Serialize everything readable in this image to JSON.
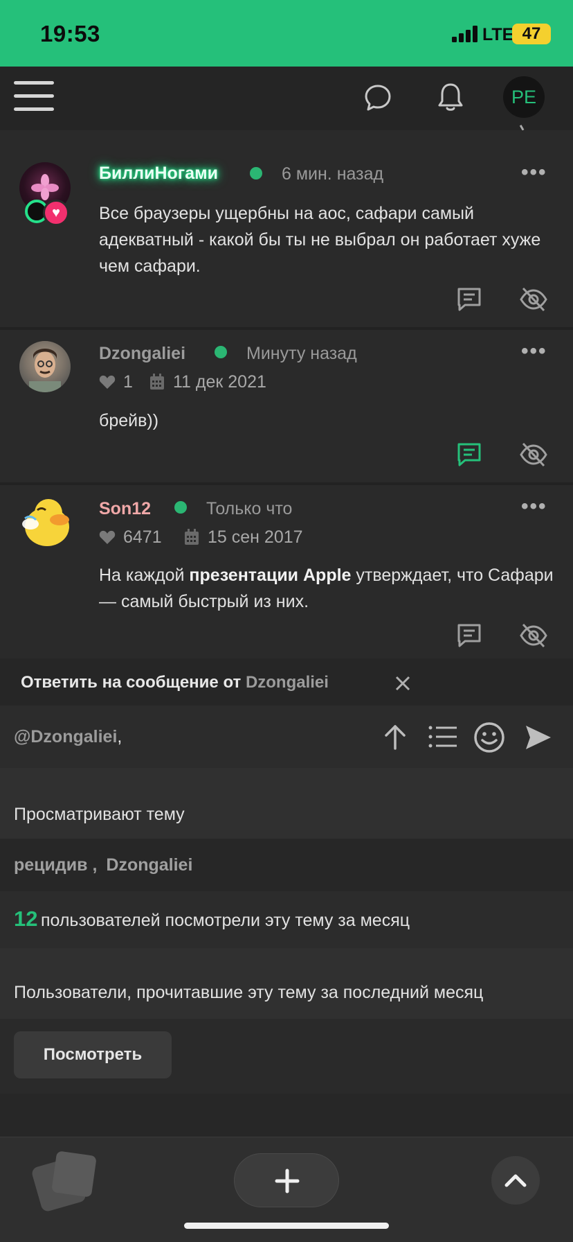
{
  "status_bar": {
    "time": "19:53",
    "network": "LTE",
    "battery": "47"
  },
  "header": {
    "user_initials": "PE"
  },
  "posts": [
    {
      "username": "БиллиНогами",
      "time": "6 мин. назад",
      "text": "Все браузеры ущербны на аос, сафари самый адекватный - какой бы ты не выбрал он работает хуже чем сафари."
    },
    {
      "username": "Dzongaliei",
      "time": "Минуту назад",
      "likes": "1",
      "joined": "11 дек 2021",
      "text": "брейв))"
    },
    {
      "username": "Son12",
      "time": "Только что",
      "likes": "6471",
      "joined": "15 сен 2017",
      "text_before": "На каждой ",
      "text_bold": "презентации Apple",
      "text_after": " утверждает, что Сафари — самый быстрый из них."
    }
  ],
  "reply": {
    "prefix": "Ответить на сообщение от",
    "user": "Dzongaliei",
    "mention": "@Dzongaliei",
    "mention_suffix": ","
  },
  "viewing": {
    "title": "Просматривают тему",
    "user1": "рецидив",
    "separator": ",",
    "user2": "Dzongaliei"
  },
  "monthly": {
    "count": "12",
    "text": "пользователей посмотрели эту тему за месяц"
  },
  "readers": {
    "title": "Пользователи, прочитавшие эту тему за последний месяц",
    "button": "Посмотреть"
  },
  "colors": {
    "accent": "#25c07a",
    "son12": "#f0a8a8",
    "glow": "#25e08a"
  }
}
